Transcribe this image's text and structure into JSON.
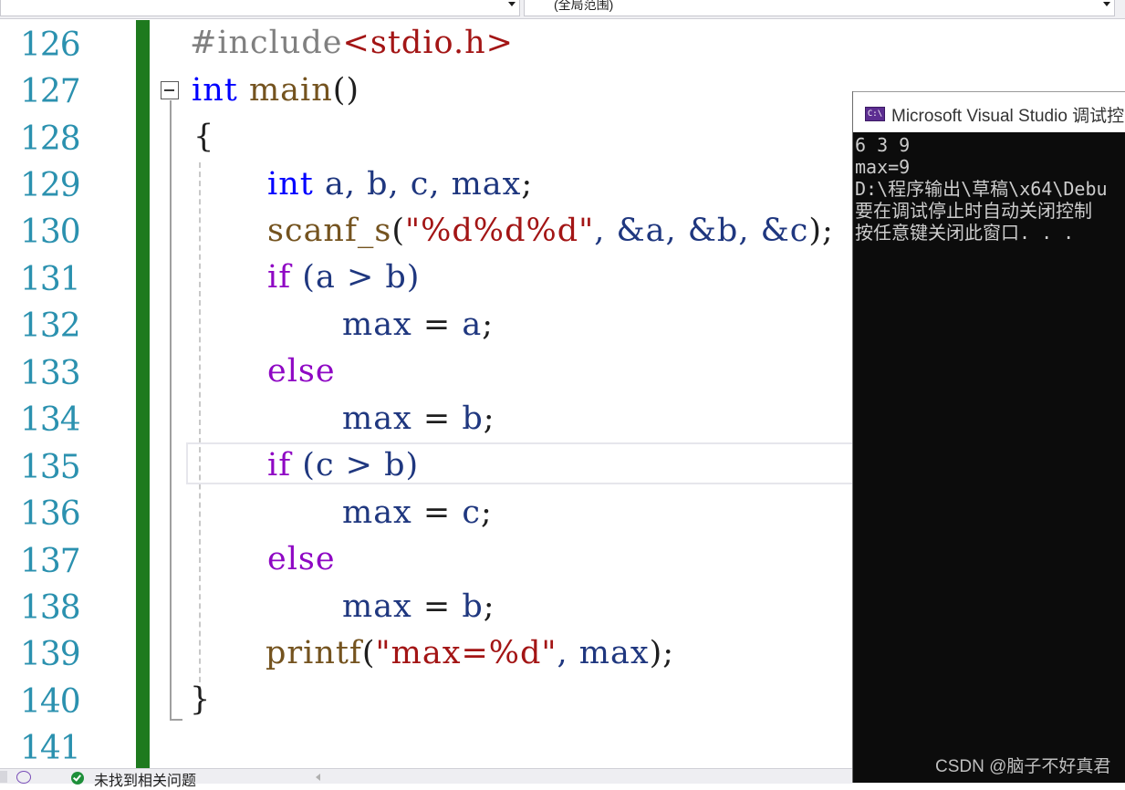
{
  "topbar": {
    "scope_label": "(全局范围)"
  },
  "editor": {
    "line_numbers": [
      "126",
      "127",
      "128",
      "129",
      "130",
      "131",
      "132",
      "133",
      "134",
      "135",
      "136",
      "137",
      "138",
      "139",
      "140",
      "141"
    ],
    "code": {
      "l126": {
        "directive": "#include",
        "header": "<stdio.h>"
      },
      "l127": {
        "type": "int",
        "func": "main",
        "parens": "()"
      },
      "l128": {
        "brace_open": "{"
      },
      "l129": {
        "type": "int",
        "vars": "a, b, c, max",
        "semi": ";"
      },
      "l130": {
        "func": "scanf_s",
        "open": "(",
        "fmt": "\"%d%d%d\"",
        "args": ", &a, &b, &c",
        "close": ");"
      },
      "l131": {
        "kw": "if",
        "cond": "(a > b)"
      },
      "l132": {
        "var": "max",
        "op": " = ",
        "val": "a",
        "semi": ";"
      },
      "l133": {
        "kw": "else"
      },
      "l134": {
        "var": "max",
        "op": " = ",
        "val": "b",
        "semi": ";"
      },
      "l135": {
        "kw": "if",
        "cond": "(c > b)"
      },
      "l136": {
        "var": "max",
        "op": " = ",
        "val": "c",
        "semi": ";"
      },
      "l137": {
        "kw": "else"
      },
      "l138": {
        "var": "max",
        "op": " = ",
        "val": "b",
        "semi": ";"
      },
      "l139": {
        "func": "printf",
        "open": "(",
        "fmt": "\"max=%d\"",
        "args": ", max",
        "close": ");"
      },
      "l140": {
        "brace_close": "}"
      }
    }
  },
  "console": {
    "icon_text": "C:\\",
    "title": "Microsoft Visual Studio 调试控",
    "lines": [
      "6 3 9",
      "max=9",
      "D:\\程序输出\\草稿\\x64\\Debu",
      "要在调试停止时自动关闭控制",
      "按任意键关闭此窗口. . ."
    ]
  },
  "status": {
    "message": "未找到相关问题"
  },
  "watermark": "CSDN @脑子不好真君",
  "colors": {
    "keyword": "#0000ff",
    "control": "#8f08c4",
    "variable": "#1f377f",
    "function": "#74531f",
    "string": "#a31515",
    "line_number": "#2b91af",
    "change_bar": "#1e7a1e",
    "console_bg": "#0c0c0c"
  }
}
